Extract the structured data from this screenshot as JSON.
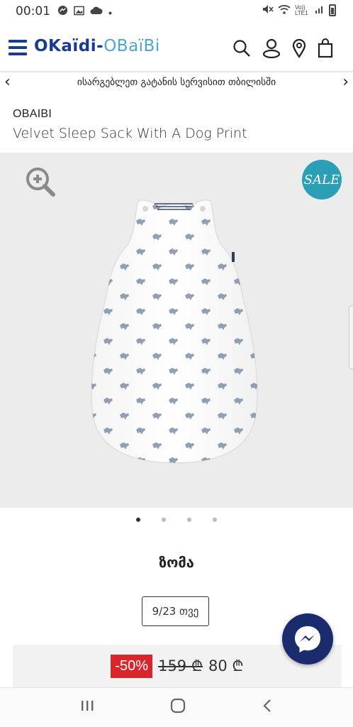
{
  "status_bar": {
    "time": "00:01",
    "network": "Vo)) LTE1"
  },
  "header": {
    "logo_primary": "OKaïdi",
    "logo_separator": "-",
    "logo_secondary": "OBaïBi"
  },
  "promo": {
    "text": "ისარგებლეთ გატანის სერვისით თბილისში"
  },
  "product": {
    "brand": "OBAIBI",
    "title": "Velvet Sleep Sack With A Dog Print",
    "sale_badge": "SALE",
    "size_heading": "ზომა",
    "size_option": "9/23 თვე",
    "discount": "-50%",
    "old_price": "159 ₾",
    "new_price": "80 ₾"
  },
  "gallery": {
    "slide_count": 4,
    "active_slide": 1
  },
  "colors": {
    "brand_blue": "#1a3c8e",
    "brand_light_blue": "#4aa6d8",
    "sale_teal": "#2a9fb5",
    "discount_red": "#d9262c",
    "messenger_navy": "#1a2c6e"
  }
}
